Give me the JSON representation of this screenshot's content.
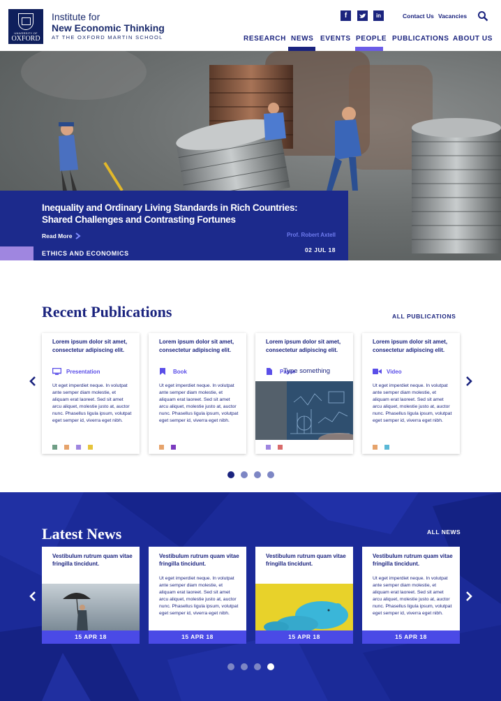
{
  "header": {
    "logo": {
      "university": "UNIVERSITY OF",
      "oxford": "OXFORD"
    },
    "brand": {
      "line1": "Institute for",
      "line2": "New Economic Thinking",
      "line3": "AT THE OXFORD MARTIN SCHOOL"
    },
    "social": [
      {
        "name": "facebook",
        "glyph": "f"
      },
      {
        "name": "twitter",
        "glyph": "t"
      },
      {
        "name": "linkedin",
        "glyph": "in"
      }
    ],
    "top_links": {
      "contact": "Contact Us",
      "vacancies": "Vacancies"
    },
    "nav": [
      "RESEARCH",
      "NEWS",
      "EVENTS",
      "PEOPLE",
      "PUBLICATIONS",
      "ABOUT US"
    ],
    "nav_active": {
      "NEWS": "#1a237e",
      "PEOPLE": "#6b5ce7"
    }
  },
  "hero": {
    "title": "Inequality and Ordinary Living Standards in Rich Countries: Shared Challenges and Contrasting Fortunes",
    "read_more": "Read More",
    "author": "Prof. Robert Axtell",
    "date": "02 JUL 18",
    "category": "ETHICS AND ECONOMICS"
  },
  "publications": {
    "title": "Recent Publications",
    "all_link": "ALL PUBLICATIONS",
    "cards": [
      {
        "title": "Lorem ipsum dolor sit amet, consectetur adipiscing elit.",
        "type": "Presentation",
        "icon": "monitor-icon",
        "body": "Ut eget imperdiet neque. In volutpat ante semper diam molestie, et aliquam erat laoreet. Sed sit amet arcu aliquet, molestie justo at, auctor nunc. Phasellus ligula ipsum, volutpat eget semper id, viverra eget nibh.",
        "tags": [
          "#6f9e86",
          "#e6a36b",
          "#9f86e0",
          "#e6c43c"
        ]
      },
      {
        "title": "Lorem ipsum dolor sit amet, consectetur adipiscing elit.",
        "type": "Book",
        "icon": "bookmark-icon",
        "body": "Ut eget imperdiet neque. In volutpat ante semper diam molestie, et aliquam erat laoreet. Sed sit amet arcu aliquet, molestie justo at, auctor nunc. Phasellus ligula ipsum, volutpat eget semper id, viverra eget nibh.",
        "tags": [
          "#e6a36b",
          "#7b3bbf"
        ]
      },
      {
        "title": "Lorem ipsum dolor sit amet, consectetur adipiscing elit.",
        "type": "Paper",
        "icon": "document-icon",
        "overlay_text": "Type something",
        "tags": [
          "#9f86e0",
          "#d96b6b"
        ]
      },
      {
        "title": "Lorem ipsum dolor sit amet, consectetur adipiscing elit.",
        "type": "Video",
        "icon": "video-icon",
        "body": "Ut eget imperdiet neque. In volutpat ante semper diam molestie, et aliquam erat laoreet. Sed sit amet arcu aliquet, molestie justo at, auctor nunc. Phasellus ligula ipsum, volutpat eget semper id, viverra eget nibh.",
        "tags": [
          "#e6a36b",
          "#5bb8d6"
        ]
      }
    ],
    "active_page": 1,
    "page_count": 4
  },
  "news": {
    "title": "Latest News",
    "all_link": "ALL NEWS",
    "cards": [
      {
        "title": "Vestibulum rutrum quam vitae fringilla tincidunt.",
        "image": "umbrella-man",
        "date": "15 APR 18"
      },
      {
        "title": "Vestibulum rutrum quam vitae fringilla tincidunt.",
        "body": "Ut eget imperdiet neque. In volutpat ante semper diam molestie, et aliquam erat laoreet. Sed sit amet arcu aliquet, molestie justo at, auctor nunc. Phasellus ligula ipsum, volutpat eget semper id, viverra eget nibh.",
        "date": "15 APR 18"
      },
      {
        "title": "Vestibulum rutrum quam vitae fringilla tincidunt.",
        "image": "piggy-bank",
        "date": "15 APR 18"
      },
      {
        "title": "Vestibulum rutrum quam vitae fringilla tincidunt.",
        "body": "Ut eget imperdiet neque. In volutpat ante semper diam molestie, et aliquam erat laoreet. Sed sit amet arcu aliquet, molestie justo at, auctor nunc. Phasellus ligula ipsum, volutpat eget semper id, viverra eget nibh.",
        "date": "15 APR 18"
      }
    ],
    "active_page": 4,
    "page_count": 4
  },
  "colors": {
    "navy": "#1a237e",
    "hero_panel": "#1c2a8c",
    "news_bg": "#1b2a98",
    "accent_violet": "#6b5ce7",
    "date_bar": "#4a4ae6"
  }
}
